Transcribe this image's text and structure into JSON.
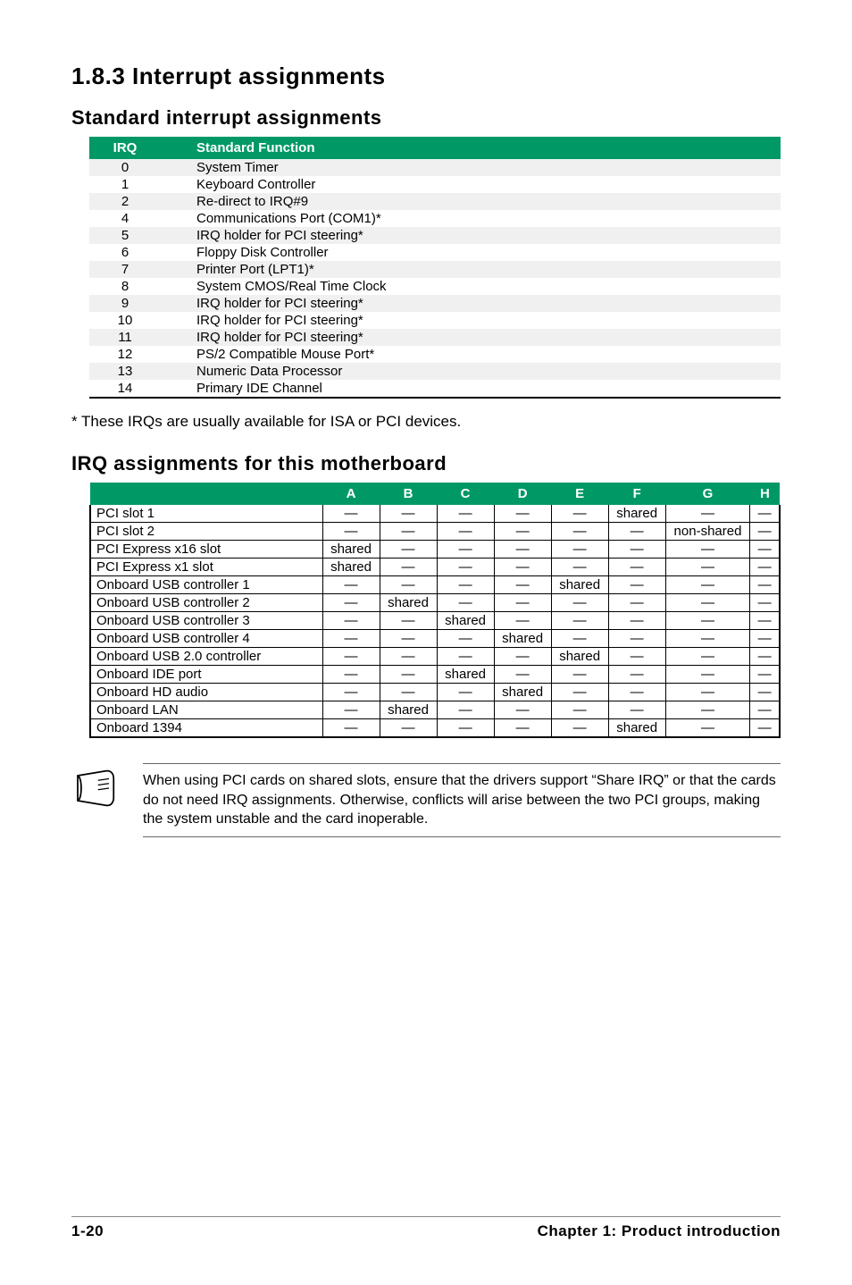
{
  "section_heading": "1.8.3   Interrupt assignments",
  "sub1_heading": "Standard interrupt assignments",
  "std_table": {
    "headers": [
      "IRQ",
      "Standard Function"
    ],
    "rows": [
      [
        "0",
        "System Timer"
      ],
      [
        "1",
        "Keyboard Controller"
      ],
      [
        "2",
        "Re-direct to IRQ#9"
      ],
      [
        "4",
        "Communications Port (COM1)*"
      ],
      [
        "5",
        "IRQ holder for PCI steering*"
      ],
      [
        "6",
        "Floppy Disk Controller"
      ],
      [
        "7",
        "Printer Port (LPT1)*"
      ],
      [
        "8",
        "System CMOS/Real Time Clock"
      ],
      [
        "9",
        "IRQ holder for PCI steering*"
      ],
      [
        "10",
        "IRQ holder for PCI steering*"
      ],
      [
        "11",
        "IRQ holder for PCI steering*"
      ],
      [
        "12",
        "PS/2 Compatible Mouse Port*"
      ],
      [
        "13",
        "Numeric Data Processor"
      ],
      [
        "14",
        "Primary IDE Channel"
      ]
    ]
  },
  "footnote": "* These IRQs are usually available for ISA or PCI devices.",
  "sub2_heading": "IRQ assignments for this motherboard",
  "irq_table": {
    "headers": [
      "",
      "A",
      "B",
      "C",
      "D",
      "E",
      "F",
      "G",
      "H"
    ],
    "rows": [
      [
        "PCI slot 1",
        "—",
        "—",
        "—",
        "—",
        "—",
        "shared",
        "—",
        "—"
      ],
      [
        "PCI slot 2",
        "—",
        "—",
        "—",
        "—",
        "—",
        "—",
        "non-shared",
        "—"
      ],
      [
        "PCI Express x16 slot",
        "shared",
        "—",
        "—",
        "—",
        "—",
        "—",
        "—",
        "—"
      ],
      [
        "PCI Express x1 slot",
        "shared",
        "—",
        "—",
        "—",
        "—",
        "—",
        "—",
        "—"
      ],
      [
        "Onboard USB controller 1",
        "—",
        "—",
        "—",
        "—",
        "shared",
        "—",
        "—",
        "—"
      ],
      [
        "Onboard USB controller 2",
        "—",
        "shared",
        "—",
        "—",
        "—",
        "—",
        "—",
        "—"
      ],
      [
        "Onboard USB controller 3",
        "—",
        "—",
        "shared",
        "—",
        "—",
        "—",
        "—",
        "—"
      ],
      [
        "Onboard USB controller 4",
        "—",
        "—",
        "—",
        "shared",
        "—",
        "—",
        "—",
        "—"
      ],
      [
        "Onboard USB 2.0 controller",
        "—",
        "—",
        "—",
        "—",
        "shared",
        "—",
        "—",
        "—"
      ],
      [
        "Onboard IDE port",
        "—",
        "—",
        "shared",
        "—",
        "—",
        "—",
        "—",
        "—"
      ],
      [
        "Onboard HD audio",
        "—",
        "—",
        "—",
        "shared",
        "—",
        "—",
        "—",
        "—"
      ],
      [
        "Onboard LAN",
        "—",
        "shared",
        "—",
        "—",
        "—",
        "—",
        "—",
        "—"
      ],
      [
        "Onboard 1394",
        "—",
        "—",
        "—",
        "—",
        "—",
        "shared",
        "—",
        "—"
      ]
    ]
  },
  "note_text": "When using PCI cards on shared slots, ensure that the drivers support “Share IRQ” or that the cards do not need IRQ assignments. Otherwise, conflicts will arise between the two PCI groups, making the system unstable and the card inoperable.",
  "footer_left": "1-20",
  "footer_right": "Chapter 1: Product introduction"
}
